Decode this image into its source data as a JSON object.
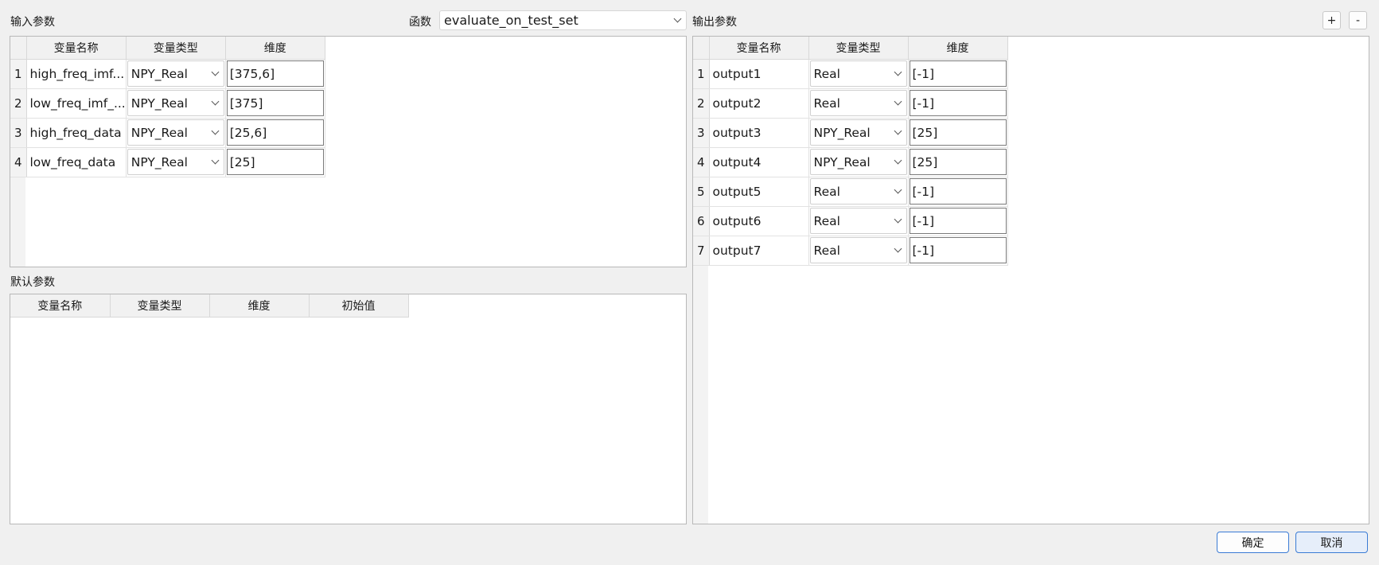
{
  "input_section": {
    "title": "输入参数",
    "columns": [
      "变量名称",
      "变量类型",
      "维度"
    ],
    "rows": [
      {
        "index": "1",
        "name": "high_freq_imf...",
        "type": "NPY_Real",
        "dim": "[375,6]"
      },
      {
        "index": "2",
        "name": "low_freq_imf_...",
        "type": "NPY_Real",
        "dim": "[375]"
      },
      {
        "index": "3",
        "name": "high_freq_data",
        "type": "NPY_Real",
        "dim": "[25,6]"
      },
      {
        "index": "4",
        "name": "low_freq_data",
        "type": "NPY_Real",
        "dim": "[25]"
      }
    ]
  },
  "function": {
    "label": "函数",
    "value": "evaluate_on_test_set"
  },
  "default_section": {
    "title": "默认参数",
    "columns": [
      "变量名称",
      "变量类型",
      "维度",
      "初始值"
    ]
  },
  "output_section": {
    "title": "输出参数",
    "add_label": "+",
    "remove_label": "-",
    "columns": [
      "变量名称",
      "变量类型",
      "维度"
    ],
    "rows": [
      {
        "index": "1",
        "name": "output1",
        "type": "Real",
        "dim": "[-1]"
      },
      {
        "index": "2",
        "name": "output2",
        "type": "Real",
        "dim": "[-1]"
      },
      {
        "index": "3",
        "name": "output3",
        "type": "NPY_Real",
        "dim": "[25]"
      },
      {
        "index": "4",
        "name": "output4",
        "type": "NPY_Real",
        "dim": "[25]"
      },
      {
        "index": "5",
        "name": "output5",
        "type": "Real",
        "dim": "[-1]"
      },
      {
        "index": "6",
        "name": "output6",
        "type": "Real",
        "dim": "[-1]"
      },
      {
        "index": "7",
        "name": "output7",
        "type": "Real",
        "dim": "[-1]"
      }
    ]
  },
  "dialog_buttons": {
    "ok_label": "确定",
    "cancel_label": "取消"
  },
  "colors": {
    "background": "#f0f0f0",
    "accent_border": "#3a7bd5",
    "cancel_fill": "#e6eefa"
  },
  "icons": {
    "dropdown": "chevron-down-icon"
  }
}
